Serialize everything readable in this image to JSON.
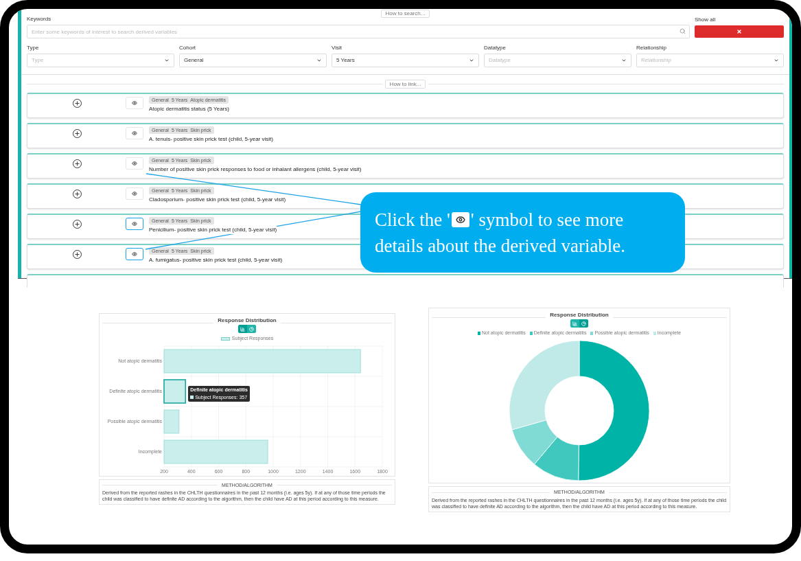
{
  "search": {
    "help_button": "How to search...",
    "keywords_label": "Keywords",
    "keywords_placeholder": "Enter some keywords of interest to search derived variables",
    "show_all_label": "Show all"
  },
  "filters": [
    {
      "label": "Type",
      "placeholder": "Type"
    },
    {
      "label": "Cohort",
      "value": "General"
    },
    {
      "label": "Visit",
      "value": "5 Years"
    },
    {
      "label": "Datatype",
      "placeholder": "Datatype"
    },
    {
      "label": "Relationship",
      "placeholder": "Relationship"
    }
  ],
  "link_button": "How to link...",
  "variables": [
    {
      "tags": [
        "General",
        "5 Years",
        "Atopic dermatitis"
      ],
      "title": "Atopic dermatitis status (5 Years)",
      "highlighted": false
    },
    {
      "tags": [
        "General",
        "5 Years",
        "Skin prick"
      ],
      "title": "A. tenuis- positive skin prick test (child, 5-year visit)",
      "highlighted": false
    },
    {
      "tags": [
        "General",
        "5 Years",
        "Skin prick"
      ],
      "title": "Number of positive skin prick responses to food or inhalant allergens (child, 5-year visit)",
      "highlighted": false
    },
    {
      "tags": [
        "General",
        "5 Years",
        "Skin prick"
      ],
      "title": "Cladosporium- positive skin prick test (child, 5-year visit)",
      "highlighted": false
    },
    {
      "tags": [
        "General",
        "5 Years",
        "Skin prick"
      ],
      "title": "Penicilium- positive skin prick test (child, 5-year visit)",
      "highlighted": true
    },
    {
      "tags": [
        "General",
        "5 Years",
        "Skin prick"
      ],
      "title": "A. fumigatus- positive skin prick test (child, 5-year visit)",
      "highlighted": true
    }
  ],
  "callout": {
    "text_before": "Click the '",
    "text_after": "' symbol to see more details about the derived variable."
  },
  "charts": [
    {
      "title": "Response Distribution",
      "views": [
        {
          "kind": "bar",
          "selected": true
        },
        {
          "kind": "pie",
          "selected": false
        }
      ],
      "chart_data": {
        "type": "bar",
        "orientation": "horizontal",
        "grid": true,
        "categories": [
          "Not atopic dermatitis",
          "Definite atopic dermatitis",
          "Possible atopic dermatitis",
          "Incomplete"
        ],
        "series": [
          {
            "name": "Subject Responses",
            "color": "#c9eeeb",
            "values": [
              1640,
              357,
              310,
              960
            ]
          }
        ],
        "xlim": [
          200,
          1800
        ],
        "xticks": [
          200,
          400,
          600,
          800,
          1000,
          1200,
          1400,
          1600,
          1800
        ]
      },
      "bars": [
        {
          "hovered": false
        },
        {
          "hovered": true
        },
        {
          "hovered": false
        },
        {
          "hovered": false
        }
      ],
      "tooltip": {
        "title": "Definite atopic dermatitis",
        "text": "Subject Responses: 357"
      },
      "method": {
        "heading": "METHOD/ALGORITHM",
        "text": "Derived from the reported rashes in the CHLTH questionnaires in the past 12 months (i.e. ages 5y). If at any of those time periods the child was classified to have definite AD according to the algorithm, then the child have AD at this period according to this measure."
      }
    },
    {
      "title": "Response Distribution",
      "views": [
        {
          "kind": "bar",
          "selected": false
        },
        {
          "kind": "pie",
          "selected": true
        }
      ],
      "legend_markers": [
        {
          "color": "#00b3a7"
        },
        {
          "color": "#40c8bf"
        },
        {
          "color": "#80dbd4"
        },
        {
          "color": "#bfeae7"
        }
      ],
      "chart_data": {
        "type": "donut",
        "categories": [
          "Not atopic dermatitis",
          "Definite atopic dermatitis",
          "Possible atopic dermatitis",
          "Incomplete"
        ],
        "series": [
          {
            "values": [
              50.2,
              10.9,
              9.5,
              29.4
            ]
          }
        ]
      },
      "method": {
        "heading": "METHOD/ALGORITHM",
        "text": "Derived from the reported rashes in the CHLTH questionnaires in the past 12 months (i.e. ages 5y). If at any of those time periods the child was classified to have definite AD according to the algorithm, then the child have AD at this period according to this measure."
      }
    }
  ]
}
